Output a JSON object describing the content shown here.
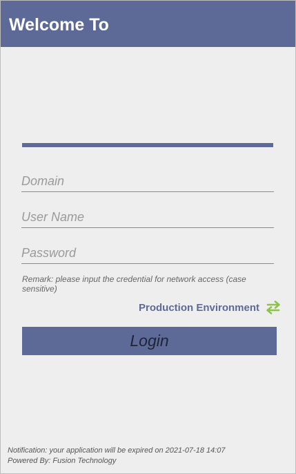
{
  "app_bar": {
    "title": "Welcome To"
  },
  "form": {
    "domain_placeholder": "Domain",
    "username_placeholder": "User Name",
    "password_placeholder": "Password",
    "remark": "Remark: please input the credential for network access (case sensitive)"
  },
  "environment": {
    "label": "Production Environment",
    "icon": "swap-arrows-icon"
  },
  "login_button": {
    "label": "Login"
  },
  "footer": {
    "notification": "Notification: your application will be expired on 2021-07-18 14:07",
    "powered_by": "Powered By: Fusion Technology"
  },
  "colors": {
    "primary": "#5d6a98",
    "background": "#eeeeee",
    "accent": "#8bc34a"
  }
}
